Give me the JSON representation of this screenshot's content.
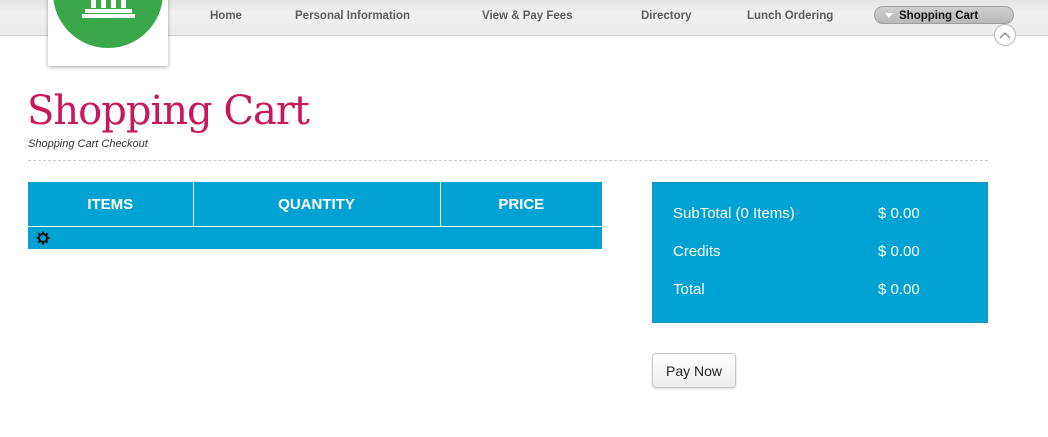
{
  "nav": {
    "items": [
      {
        "label": "Home"
      },
      {
        "label": "Personal Information"
      },
      {
        "label": "View & Pay Fees"
      },
      {
        "label": "Directory"
      },
      {
        "label": "Lunch Ordering"
      },
      {
        "label": "Shopping Cart",
        "active": true
      }
    ],
    "collapse_icon": "chevron-up-icon"
  },
  "logo": {
    "icon": "building-columns-icon",
    "color": "#3aa84a"
  },
  "page": {
    "title": "Shopping Cart",
    "subtitle": "Shopping Cart Checkout"
  },
  "cart_table": {
    "columns": [
      "ITEMS",
      "QUANTITY",
      "PRICE"
    ],
    "loading_icon": "spinner-icon"
  },
  "summary": {
    "rows": [
      {
        "label": "SubTotal (0 Items)",
        "value": "$ 0.00"
      },
      {
        "label": "Credits",
        "value": "$ 0.00"
      },
      {
        "label": "Total",
        "value": "$ 0.00"
      }
    ]
  },
  "actions": {
    "pay_now_label": "Pay Now"
  },
  "colors": {
    "accent_blue": "#00a2d3",
    "title_pink": "#c8175d",
    "logo_green": "#3aa84a"
  }
}
